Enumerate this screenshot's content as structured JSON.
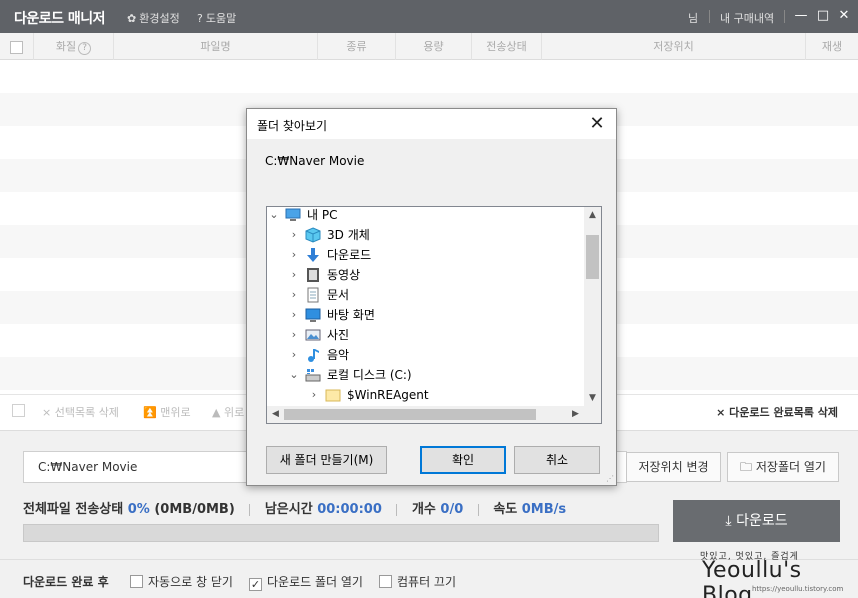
{
  "app": {
    "title": "다운로드 매니저",
    "settings_label": "환경설정",
    "help_label": "도움말",
    "user_label": "님",
    "purchases_label": "내 구매내역"
  },
  "columns": {
    "quality": "화질",
    "filename": "파일명",
    "type": "종류",
    "size": "용량",
    "status": "전송상태",
    "location": "저장위치",
    "play": "재생"
  },
  "actions": {
    "delete_selected": "× 선택목록 삭제",
    "to_top": "맨위로",
    "up": "위로",
    "delete_completed": "× 다운로드 완료목록 삭제"
  },
  "bottom": {
    "path_value": "C:₩Naver Movie",
    "change_location": "저장위치 변경",
    "open_folder": "저장폴더 열기",
    "status_prefix": "전체파일 전송상태",
    "status_percent": "0%",
    "status_size": "(0MB/0MB)",
    "remaining_label": "남은시간",
    "remaining_value": "00:00:00",
    "count_label": "개수",
    "count_value": "0/0",
    "speed_label": "속도",
    "speed_value": "0MB/s",
    "progress": 0,
    "download_button": "다운로드",
    "after_label": "다운로드 완료 후",
    "opt_auto_close": "자동으로 창 닫기",
    "opt_open_folder": "다운로드 폴더 열기",
    "opt_shutdown": "컴퓨터 끄기",
    "opt_auto_close_checked": false,
    "opt_open_folder_checked": true,
    "opt_shutdown_checked": false
  },
  "dialog": {
    "title": "폴더 찾아보기",
    "current_path": "C:₩Naver Movie",
    "tree": [
      {
        "label": "내 PC",
        "icon": "pc-icon",
        "expanded": true,
        "level": 0
      },
      {
        "label": "3D 개체",
        "icon": "cube-icon",
        "expanded": false,
        "level": 1
      },
      {
        "label": "다운로드",
        "icon": "download-arrow-icon",
        "expanded": false,
        "level": 1
      },
      {
        "label": "동영상",
        "icon": "video-icon",
        "expanded": false,
        "level": 1
      },
      {
        "label": "문서",
        "icon": "document-icon",
        "expanded": false,
        "level": 1
      },
      {
        "label": "바탕 화면",
        "icon": "desktop-icon",
        "expanded": false,
        "level": 1
      },
      {
        "label": "사진",
        "icon": "picture-icon",
        "expanded": false,
        "level": 1
      },
      {
        "label": "음악",
        "icon": "music-icon",
        "expanded": false,
        "level": 1
      },
      {
        "label": "로컬 디스크 (C:)",
        "icon": "drive-icon",
        "expanded": true,
        "level": 1
      },
      {
        "label": "$WinREAgent",
        "icon": "folder-icon",
        "expanded": false,
        "level": 2
      }
    ],
    "new_folder_button": "새 폴더 만들기(M)",
    "ok_button": "확인",
    "cancel_button": "취소"
  },
  "watermark": {
    "sub": "맛있고, 멋있고, 즐겁게",
    "main": "Yeoullu's Blog",
    "url": "https://yeoullu.tistory.com"
  },
  "colors": {
    "titlebar": "#5f6267",
    "accent_blue": "#3a6fc4",
    "download_button": "#696c70",
    "dialog_primary_border": "#0078d7"
  }
}
